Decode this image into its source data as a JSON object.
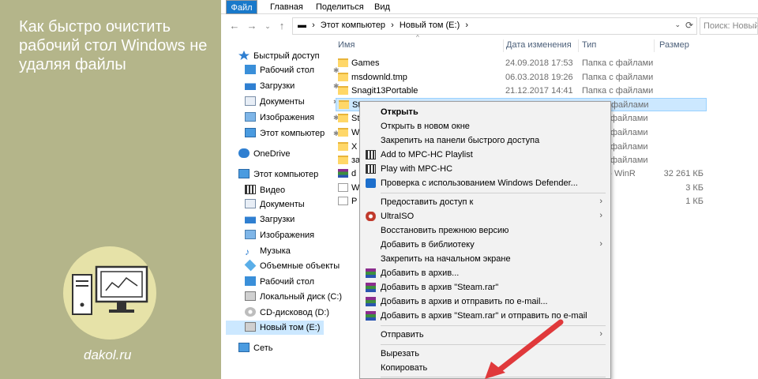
{
  "promo": {
    "headline": "Как быстро очистить рабочий стол Windows не удаляя файлы",
    "site": "dakol.ru",
    "colors": {
      "background": "#b4b58a",
      "circle": "#e6e2a8"
    }
  },
  "ribbon": {
    "tabs": [
      "Файл",
      "Главная",
      "Поделиться",
      "Вид"
    ],
    "file_color": "#1979ca"
  },
  "address": {
    "crumbs": [
      "Этот компьютер",
      "Новый том (E:)"
    ],
    "search_placeholder": "Поиск: Новый т"
  },
  "nav": {
    "items": [
      {
        "label": "Быстрый доступ",
        "icon": "star-icon",
        "pinned": false
      },
      {
        "label": "Рабочий стол",
        "icon": "desktop-icon",
        "pinned": true
      },
      {
        "label": "Загрузки",
        "icon": "download-icon",
        "pinned": true
      },
      {
        "label": "Документы",
        "icon": "documents-icon",
        "pinned": true
      },
      {
        "label": "Изображения",
        "icon": "images-icon",
        "pinned": true
      },
      {
        "label": "Этот компьютер",
        "icon": "computer-icon",
        "pinned": true
      },
      {
        "label": "OneDrive",
        "icon": "cloud-icon",
        "pinned": false
      },
      {
        "label": "Этот компьютер",
        "icon": "computer-icon",
        "pinned": false
      },
      {
        "label": "Видео",
        "icon": "video-icon",
        "pinned": false
      },
      {
        "label": "Документы",
        "icon": "documents-icon",
        "pinned": false
      },
      {
        "label": "Загрузки",
        "icon": "download-icon",
        "pinned": false
      },
      {
        "label": "Изображения",
        "icon": "images-icon",
        "pinned": false
      },
      {
        "label": "Музыка",
        "icon": "music-icon",
        "pinned": false
      },
      {
        "label": "Объемные объекты",
        "icon": "3d-objects-icon",
        "pinned": false
      },
      {
        "label": "Рабочий стол",
        "icon": "desktop-icon",
        "pinned": false
      },
      {
        "label": "Локальный диск (C:)",
        "icon": "drive-icon",
        "pinned": false
      },
      {
        "label": "CD-дисковод (D:)",
        "icon": "cd-drive-icon",
        "pinned": false
      },
      {
        "label": "Новый том (E:)",
        "icon": "drive-icon",
        "pinned": false,
        "selected": true
      },
      {
        "label": "Сеть",
        "icon": "network-icon",
        "pinned": false
      }
    ]
  },
  "columns": {
    "name": "Имя",
    "date": "Дата изменения",
    "type": "Тип",
    "size": "Размер"
  },
  "files": [
    {
      "name": "Games",
      "date": "24.09.2018 17:53",
      "type": "Папка с файлами",
      "size": "",
      "icon": "folder-icon"
    },
    {
      "name": "msdownld.tmp",
      "date": "06.03.2018 19:26",
      "type": "Папка с файлами",
      "size": "",
      "icon": "folder-icon"
    },
    {
      "name": "Snagit13Portable",
      "date": "21.12.2017 14:41",
      "type": "Папка с файлами",
      "size": "",
      "icon": "folder-icon"
    },
    {
      "name": "St",
      "date": "",
      "type": "файлами",
      "size": "",
      "icon": "folder-icon",
      "selected": true
    },
    {
      "name": "St",
      "date": "",
      "type": "файлами",
      "size": "",
      "icon": "folder-icon"
    },
    {
      "name": "W",
      "date": "",
      "type": "файлами",
      "size": "",
      "icon": "folder-icon"
    },
    {
      "name": "X",
      "date": "",
      "type": "файлами",
      "size": "",
      "icon": "folder-icon"
    },
    {
      "name": "за",
      "date": "",
      "type": "файлами",
      "size": "",
      "icon": "folder-icon"
    },
    {
      "name": "d",
      "date": "",
      "type": "IP - WinR",
      "size": "32 261 КБ",
      "icon": "rar-icon"
    },
    {
      "name": "W",
      "date": "",
      "type": "",
      "size": "3 КБ",
      "icon": "file-icon"
    },
    {
      "name": "P",
      "date": "",
      "type": "",
      "size": "1 КБ",
      "icon": "file-icon"
    }
  ],
  "context_menu": {
    "items": [
      {
        "label": "Открыть",
        "bold": true,
        "icon": ""
      },
      {
        "label": "Открыть в новом окне",
        "icon": ""
      },
      {
        "label": "Закрепить на панели быстрого доступа",
        "icon": ""
      },
      {
        "label": "Add to MPC-HC Playlist",
        "icon": "mpc-hc-icon"
      },
      {
        "label": "Play with MPC-HC",
        "icon": "mpc-hc-icon"
      },
      {
        "label": "Проверка с использованием Windows Defender...",
        "icon": "defender-icon"
      },
      {
        "separator": true
      },
      {
        "label": "Предоставить доступ к",
        "icon": "",
        "submenu": true
      },
      {
        "label": "UltraISO",
        "icon": "ultraiso-icon",
        "submenu": true
      },
      {
        "label": "Восстановить прежнюю версию",
        "icon": ""
      },
      {
        "label": "Добавить в библиотеку",
        "icon": "",
        "submenu": true
      },
      {
        "label": "Закрепить на начальном экране",
        "icon": ""
      },
      {
        "label": "Добавить в архив...",
        "icon": "winrar-icon"
      },
      {
        "label": "Добавить в архив \"Steam.rar\"",
        "icon": "winrar-icon"
      },
      {
        "label": "Добавить в архив и отправить по e-mail...",
        "icon": "winrar-icon"
      },
      {
        "label": "Добавить в архив \"Steam.rar\" и отправить по e-mail",
        "icon": "winrar-icon"
      },
      {
        "separator": true
      },
      {
        "label": "Отправить",
        "icon": "",
        "submenu": true
      },
      {
        "separator": true
      },
      {
        "label": "Вырезать",
        "icon": ""
      },
      {
        "label": "Копировать",
        "icon": ""
      },
      {
        "separator": true
      }
    ]
  },
  "arrow_color": "#e0393b",
  "selection_color": "#cce8ff"
}
